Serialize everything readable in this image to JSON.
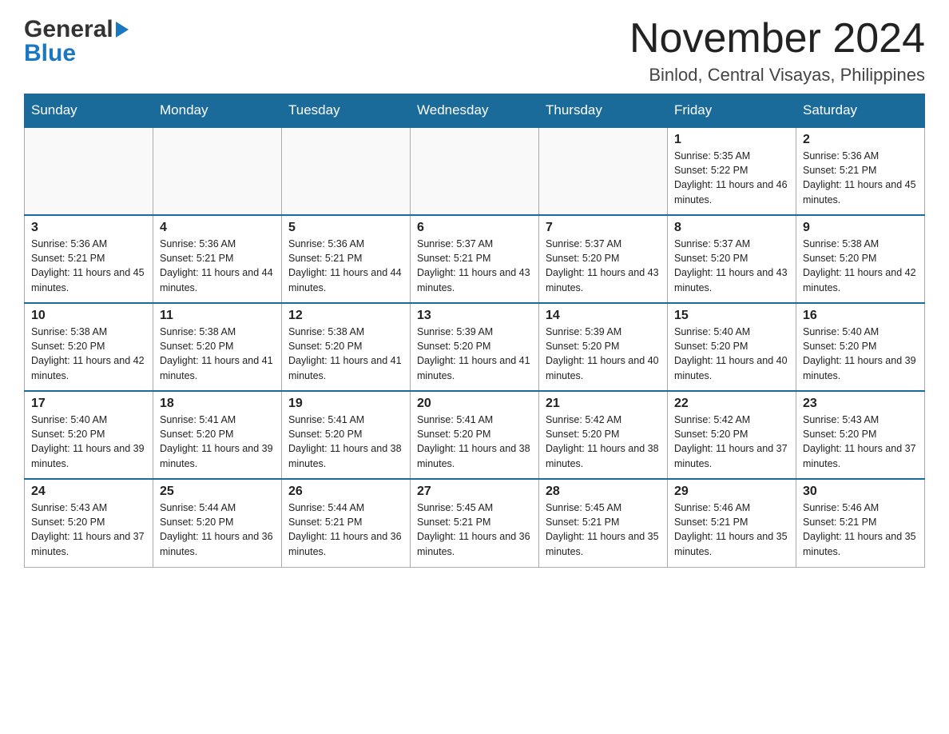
{
  "header": {
    "logo_general": "General",
    "logo_blue": "Blue",
    "month_title": "November 2024",
    "location": "Binlod, Central Visayas, Philippines"
  },
  "days_of_week": [
    "Sunday",
    "Monday",
    "Tuesday",
    "Wednesday",
    "Thursday",
    "Friday",
    "Saturday"
  ],
  "weeks": [
    {
      "days": [
        {
          "num": "",
          "sunrise": "",
          "sunset": "",
          "daylight": "",
          "empty": true
        },
        {
          "num": "",
          "sunrise": "",
          "sunset": "",
          "daylight": "",
          "empty": true
        },
        {
          "num": "",
          "sunrise": "",
          "sunset": "",
          "daylight": "",
          "empty": true
        },
        {
          "num": "",
          "sunrise": "",
          "sunset": "",
          "daylight": "",
          "empty": true
        },
        {
          "num": "",
          "sunrise": "",
          "sunset": "",
          "daylight": "",
          "empty": true
        },
        {
          "num": "1",
          "sunrise": "Sunrise: 5:35 AM",
          "sunset": "Sunset: 5:22 PM",
          "daylight": "Daylight: 11 hours and 46 minutes.",
          "empty": false
        },
        {
          "num": "2",
          "sunrise": "Sunrise: 5:36 AM",
          "sunset": "Sunset: 5:21 PM",
          "daylight": "Daylight: 11 hours and 45 minutes.",
          "empty": false
        }
      ]
    },
    {
      "days": [
        {
          "num": "3",
          "sunrise": "Sunrise: 5:36 AM",
          "sunset": "Sunset: 5:21 PM",
          "daylight": "Daylight: 11 hours and 45 minutes.",
          "empty": false
        },
        {
          "num": "4",
          "sunrise": "Sunrise: 5:36 AM",
          "sunset": "Sunset: 5:21 PM",
          "daylight": "Daylight: 11 hours and 44 minutes.",
          "empty": false
        },
        {
          "num": "5",
          "sunrise": "Sunrise: 5:36 AM",
          "sunset": "Sunset: 5:21 PM",
          "daylight": "Daylight: 11 hours and 44 minutes.",
          "empty": false
        },
        {
          "num": "6",
          "sunrise": "Sunrise: 5:37 AM",
          "sunset": "Sunset: 5:21 PM",
          "daylight": "Daylight: 11 hours and 43 minutes.",
          "empty": false
        },
        {
          "num": "7",
          "sunrise": "Sunrise: 5:37 AM",
          "sunset": "Sunset: 5:20 PM",
          "daylight": "Daylight: 11 hours and 43 minutes.",
          "empty": false
        },
        {
          "num": "8",
          "sunrise": "Sunrise: 5:37 AM",
          "sunset": "Sunset: 5:20 PM",
          "daylight": "Daylight: 11 hours and 43 minutes.",
          "empty": false
        },
        {
          "num": "9",
          "sunrise": "Sunrise: 5:38 AM",
          "sunset": "Sunset: 5:20 PM",
          "daylight": "Daylight: 11 hours and 42 minutes.",
          "empty": false
        }
      ]
    },
    {
      "days": [
        {
          "num": "10",
          "sunrise": "Sunrise: 5:38 AM",
          "sunset": "Sunset: 5:20 PM",
          "daylight": "Daylight: 11 hours and 42 minutes.",
          "empty": false
        },
        {
          "num": "11",
          "sunrise": "Sunrise: 5:38 AM",
          "sunset": "Sunset: 5:20 PM",
          "daylight": "Daylight: 11 hours and 41 minutes.",
          "empty": false
        },
        {
          "num": "12",
          "sunrise": "Sunrise: 5:38 AM",
          "sunset": "Sunset: 5:20 PM",
          "daylight": "Daylight: 11 hours and 41 minutes.",
          "empty": false
        },
        {
          "num": "13",
          "sunrise": "Sunrise: 5:39 AM",
          "sunset": "Sunset: 5:20 PM",
          "daylight": "Daylight: 11 hours and 41 minutes.",
          "empty": false
        },
        {
          "num": "14",
          "sunrise": "Sunrise: 5:39 AM",
          "sunset": "Sunset: 5:20 PM",
          "daylight": "Daylight: 11 hours and 40 minutes.",
          "empty": false
        },
        {
          "num": "15",
          "sunrise": "Sunrise: 5:40 AM",
          "sunset": "Sunset: 5:20 PM",
          "daylight": "Daylight: 11 hours and 40 minutes.",
          "empty": false
        },
        {
          "num": "16",
          "sunrise": "Sunrise: 5:40 AM",
          "sunset": "Sunset: 5:20 PM",
          "daylight": "Daylight: 11 hours and 39 minutes.",
          "empty": false
        }
      ]
    },
    {
      "days": [
        {
          "num": "17",
          "sunrise": "Sunrise: 5:40 AM",
          "sunset": "Sunset: 5:20 PM",
          "daylight": "Daylight: 11 hours and 39 minutes.",
          "empty": false
        },
        {
          "num": "18",
          "sunrise": "Sunrise: 5:41 AM",
          "sunset": "Sunset: 5:20 PM",
          "daylight": "Daylight: 11 hours and 39 minutes.",
          "empty": false
        },
        {
          "num": "19",
          "sunrise": "Sunrise: 5:41 AM",
          "sunset": "Sunset: 5:20 PM",
          "daylight": "Daylight: 11 hours and 38 minutes.",
          "empty": false
        },
        {
          "num": "20",
          "sunrise": "Sunrise: 5:41 AM",
          "sunset": "Sunset: 5:20 PM",
          "daylight": "Daylight: 11 hours and 38 minutes.",
          "empty": false
        },
        {
          "num": "21",
          "sunrise": "Sunrise: 5:42 AM",
          "sunset": "Sunset: 5:20 PM",
          "daylight": "Daylight: 11 hours and 38 minutes.",
          "empty": false
        },
        {
          "num": "22",
          "sunrise": "Sunrise: 5:42 AM",
          "sunset": "Sunset: 5:20 PM",
          "daylight": "Daylight: 11 hours and 37 minutes.",
          "empty": false
        },
        {
          "num": "23",
          "sunrise": "Sunrise: 5:43 AM",
          "sunset": "Sunset: 5:20 PM",
          "daylight": "Daylight: 11 hours and 37 minutes.",
          "empty": false
        }
      ]
    },
    {
      "days": [
        {
          "num": "24",
          "sunrise": "Sunrise: 5:43 AM",
          "sunset": "Sunset: 5:20 PM",
          "daylight": "Daylight: 11 hours and 37 minutes.",
          "empty": false
        },
        {
          "num": "25",
          "sunrise": "Sunrise: 5:44 AM",
          "sunset": "Sunset: 5:20 PM",
          "daylight": "Daylight: 11 hours and 36 minutes.",
          "empty": false
        },
        {
          "num": "26",
          "sunrise": "Sunrise: 5:44 AM",
          "sunset": "Sunset: 5:21 PM",
          "daylight": "Daylight: 11 hours and 36 minutes.",
          "empty": false
        },
        {
          "num": "27",
          "sunrise": "Sunrise: 5:45 AM",
          "sunset": "Sunset: 5:21 PM",
          "daylight": "Daylight: 11 hours and 36 minutes.",
          "empty": false
        },
        {
          "num": "28",
          "sunrise": "Sunrise: 5:45 AM",
          "sunset": "Sunset: 5:21 PM",
          "daylight": "Daylight: 11 hours and 35 minutes.",
          "empty": false
        },
        {
          "num": "29",
          "sunrise": "Sunrise: 5:46 AM",
          "sunset": "Sunset: 5:21 PM",
          "daylight": "Daylight: 11 hours and 35 minutes.",
          "empty": false
        },
        {
          "num": "30",
          "sunrise": "Sunrise: 5:46 AM",
          "sunset": "Sunset: 5:21 PM",
          "daylight": "Daylight: 11 hours and 35 minutes.",
          "empty": false
        }
      ]
    }
  ]
}
